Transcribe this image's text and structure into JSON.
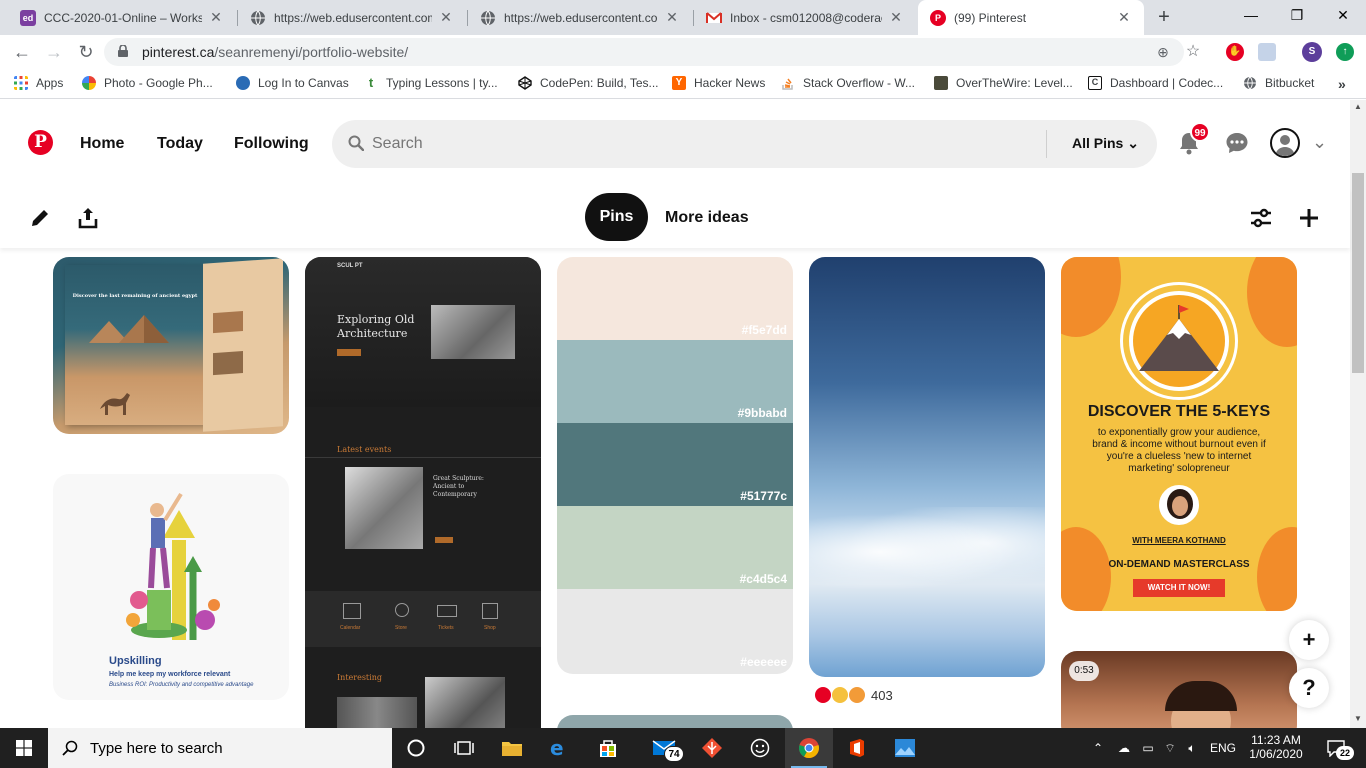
{
  "browser": {
    "tabs": [
      {
        "title": "CCC-2020-01-Online – Worksp",
        "favicon": "edusercontent-icon",
        "favicon_text": "ed",
        "favicon_color": "#7b3fa0"
      },
      {
        "title": "https://web.edusercontent.com",
        "favicon": "globe-icon"
      },
      {
        "title": "https://web.edusercontent.com",
        "favicon": "globe-icon"
      },
      {
        "title": "Inbox - csm012008@coderaca",
        "favicon": "gmail-icon"
      },
      {
        "title": "(99) Pinterest",
        "favicon": "pinterest-icon"
      }
    ],
    "url_host": "pinterest.ca",
    "url_path": "/seanremenyi/portfolio-website/",
    "profile_initial": "S",
    "bookmarks": [
      {
        "label": "Apps"
      },
      {
        "label": "Photo - Google Ph..."
      },
      {
        "label": "Log In to Canvas"
      },
      {
        "label": "Typing Lessons | ty..."
      },
      {
        "label": "CodePen: Build, Tes..."
      },
      {
        "label": "Hacker News"
      },
      {
        "label": "Stack Overflow - W..."
      },
      {
        "label": "OverTheWire: Level..."
      },
      {
        "label": "Dashboard | Codec..."
      },
      {
        "label": "Bitbucket"
      }
    ]
  },
  "pinterest": {
    "logo": "P",
    "nav": {
      "home": "Home",
      "today": "Today",
      "following": "Following"
    },
    "search_placeholder": "Search",
    "all_pins": "All Pins",
    "notification_count": "99",
    "pills": {
      "pins": "Pins",
      "more_ideas": "More ideas"
    },
    "pins": {
      "egypt": {
        "headline": "Discover the last remaining of ancient egypt"
      },
      "upskilling": {
        "title": "Upskilling",
        "subtitle": "Help me keep my workforce relevant",
        "caption": "Business ROI: Productivity and competitive advantage"
      },
      "sculpt": {
        "brand": "SCUL PT",
        "headline": "Exploring Old Architecture",
        "events": "Latest events",
        "event_title": "Great Sculpture: Ancient to Contemporary",
        "interesting": "Interesting",
        "icons": [
          "Calendar",
          "Store",
          "Tickets",
          "Shop"
        ]
      },
      "palette": {
        "colors": [
          "#f5e7dd",
          "#9bbabd",
          "#51777c",
          "#c4d5c4",
          "#eeeeee"
        ]
      },
      "reaction_count": "403",
      "masterclass": {
        "headline": "DISCOVER THE 5-KEYS",
        "body": "to exponentially grow your audience, brand & income without burnout even if you're a clueless 'new to internet marketing' solopreneur",
        "with": "WITH MEERA KOTHAND",
        "sub": "ON-DEMAND MASTERCLASS",
        "cta": "WATCH IT NOW!"
      },
      "video": {
        "duration": "0:53"
      }
    },
    "fab": {
      "add": "+",
      "help": "?"
    }
  },
  "taskbar": {
    "search_placeholder": "Type here to search",
    "mail_badge": "74",
    "language": "ENG",
    "time": "11:23 AM",
    "date": "1/06/2020",
    "notifications": "22"
  }
}
